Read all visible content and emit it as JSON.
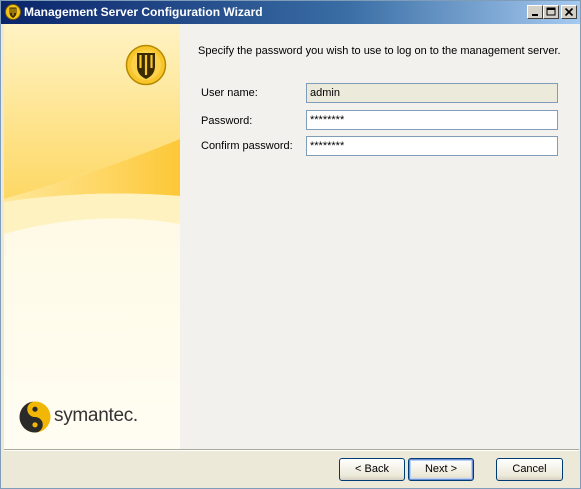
{
  "window": {
    "title": "Management Server Configuration Wizard",
    "icon": "norton-shield-icon"
  },
  "titlebar_buttons": {
    "minimize_icon": "minimize-icon",
    "maximize_icon": "maximize-icon",
    "close_icon": "close-icon"
  },
  "sidebar": {
    "logo_text": "symantec.",
    "colors": {
      "accent": "#fdc838",
      "background": "#fff9e2"
    }
  },
  "main": {
    "instruction": "Specify the password you wish to use to log on to the management server.",
    "fields": [
      {
        "label": "User name:",
        "value": "admin",
        "readonly": true
      },
      {
        "label": "Password:",
        "value": "********",
        "readonly": false
      },
      {
        "label": "Confirm password:",
        "value": "********",
        "readonly": false
      }
    ]
  },
  "buttons": {
    "back": "< Back",
    "next": "Next >",
    "cancel": "Cancel"
  }
}
